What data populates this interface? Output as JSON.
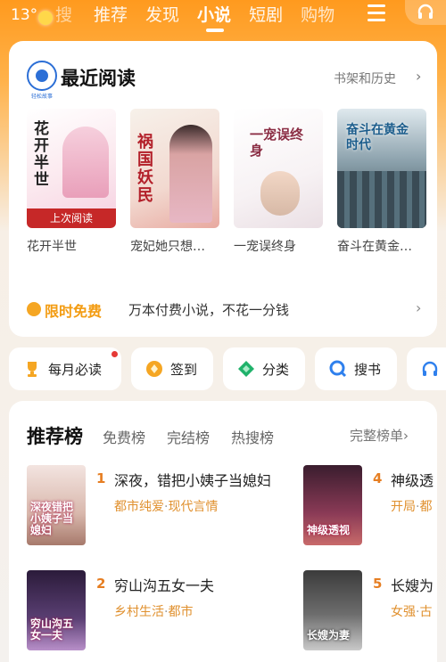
{
  "status": {
    "temperature": "13°"
  },
  "nav": {
    "search_hint": "搜",
    "tabs": [
      "推荐",
      "发现",
      "小说",
      "短剧",
      "购物"
    ],
    "active_index": 2
  },
  "recent": {
    "logo_text": "轻松故事",
    "title": "最近阅读",
    "shelf_link": "书架和历史",
    "chevron": "›",
    "last_read_label": "上次阅读",
    "books": [
      {
        "name": "花开半世",
        "cover_title": "花开半世"
      },
      {
        "name": "宠妃她只想…",
        "cover_title": "祸国妖民"
      },
      {
        "name": "一宠误终身",
        "cover_title": "一宠误终身"
      },
      {
        "name": "奋斗在黄金…",
        "cover_title": "奋斗在黄金时代"
      }
    ],
    "free": {
      "tag": "限时免费",
      "desc": "万本付费小说，不花一分钱",
      "chevron": "›"
    }
  },
  "quick": [
    {
      "label": "每月必读",
      "icon": "trophy-icon",
      "color": "#f5a623",
      "dot": true
    },
    {
      "label": "签到",
      "icon": "coin-icon",
      "color": "#f5a623",
      "dot": false
    },
    {
      "label": "分类",
      "icon": "category-icon",
      "color": "#20b26b",
      "dot": false
    },
    {
      "label": "搜书",
      "icon": "search-icon",
      "color": "#2f80ed",
      "dot": false
    },
    {
      "label": "听",
      "icon": "headphone-icon",
      "color": "#2f80ed",
      "dot": false
    }
  ],
  "rank": {
    "title": "推荐榜",
    "tabs": [
      "免费榜",
      "完结榜",
      "热搜榜"
    ],
    "all_link": "完整榜单",
    "chevron": "›",
    "items": [
      {
        "num": "1",
        "name": "深夜，错把小姨子当媳妇",
        "tag1": "都市纯爱",
        "tag2": "现代言情",
        "cover_title": "深夜错把小姨子当媳妇"
      },
      {
        "num": "4",
        "name": "神级透",
        "tag1": "开局",
        "tag2": "都",
        "cover_title": "神级透视"
      },
      {
        "num": "2",
        "name": "穷山沟五女一夫",
        "tag1": "乡村生活",
        "tag2": "都市",
        "cover_title": "穷山沟五女一夫"
      },
      {
        "num": "5",
        "name": "长嫂为",
        "tag1": "女强",
        "tag2": "古",
        "cover_title": "长嫂为妻"
      }
    ]
  },
  "colors": {
    "accent": "#ff9a1e",
    "free_tag": "#f39c12",
    "last_read": "#c62828",
    "rank_tag": "#e0902e"
  }
}
